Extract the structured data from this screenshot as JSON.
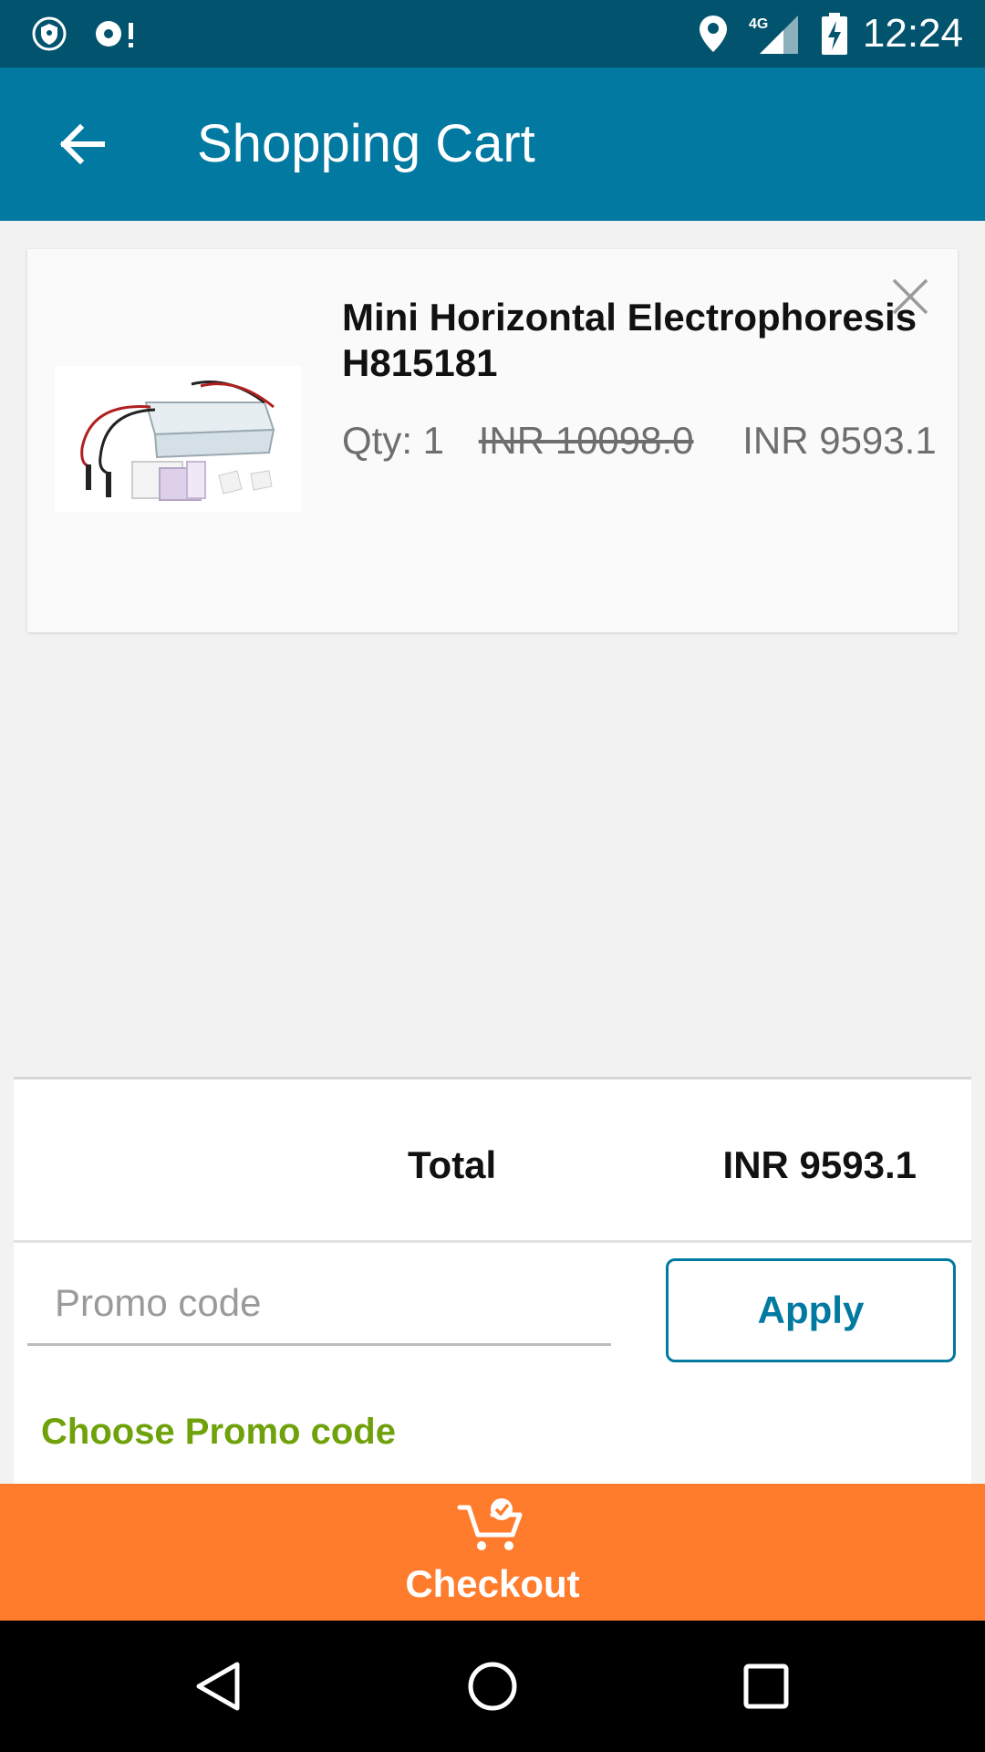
{
  "status_bar": {
    "time": "12:24",
    "network": "4G",
    "icons": [
      "shield-icon",
      "sync-alert-icon",
      "location-icon",
      "signal-icon",
      "battery-charging-icon"
    ]
  },
  "app_bar": {
    "title": "Shopping Cart",
    "back_icon": "arrow-back-icon"
  },
  "cart": {
    "items": [
      {
        "name": "Mini Horizontal Electrophoresis H815181",
        "qty": "Qty: 1",
        "original_price": "INR 10098.0",
        "price": "INR 9593.1",
        "remove_icon": "close-icon"
      }
    ]
  },
  "summary": {
    "total_label": "Total",
    "total_value": "INR 9593.1",
    "promo_placeholder": "Promo code",
    "apply_label": "Apply",
    "choose_promo_label": "Choose Promo code"
  },
  "checkout": {
    "label": "Checkout",
    "icon": "cart-check-icon"
  },
  "nav_bar": {
    "icons": [
      "back-triangle-icon",
      "home-circle-icon",
      "recents-square-icon"
    ]
  },
  "colors": {
    "status_bar": "#02536e",
    "app_bar": "#0279a0",
    "accent_green": "#6fa10a",
    "checkout": "#fe7c2c"
  }
}
